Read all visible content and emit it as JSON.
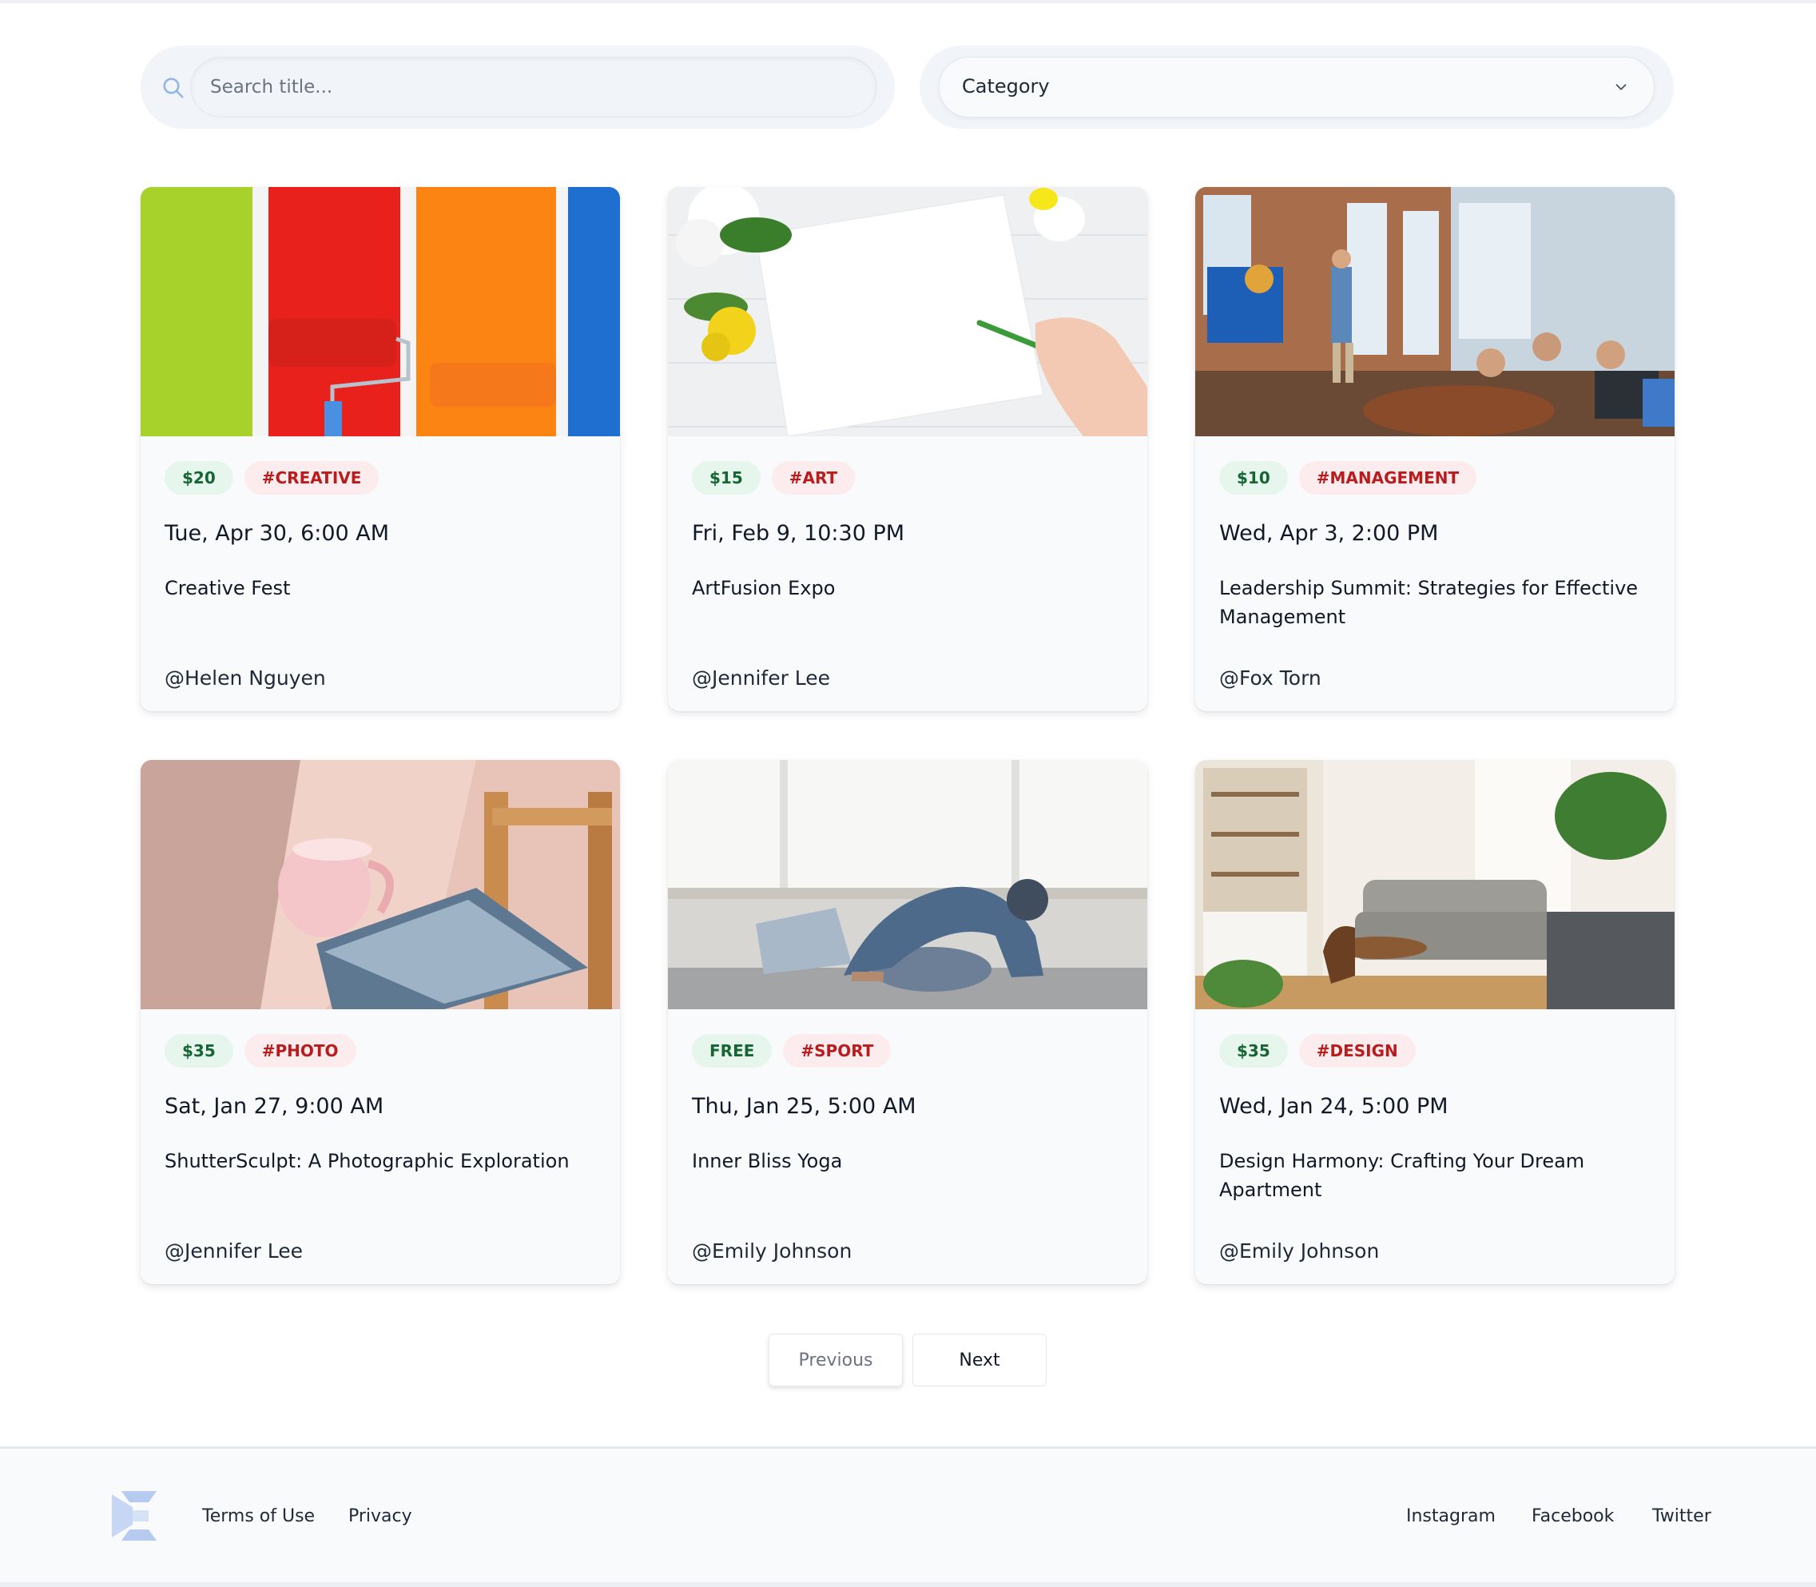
{
  "search": {
    "placeholder": "Search title..."
  },
  "filter": {
    "category_label": "Category"
  },
  "events": [
    {
      "price": "$20",
      "tag": "#CREATIVE",
      "date": "Tue, Apr 30, 6:00 AM",
      "title": "Creative Fest",
      "author": "@Helen Nguyen",
      "image": "paint-rollers-image"
    },
    {
      "price": "$15",
      "tag": "#ART",
      "date": "Fri, Feb 9, 10:30 PM",
      "title": "ArtFusion Expo",
      "author": "@Jennifer Lee",
      "image": "drawing-paper-image"
    },
    {
      "price": "$10",
      "tag": "#MANAGEMENT",
      "date": "Wed, Apr 3, 2:00 PM",
      "title": "Leadership Summit: Strategies for Effective Management",
      "author": "@Fox Torn",
      "image": "office-meeting-image"
    },
    {
      "price": "$35",
      "tag": "#PHOTO",
      "date": "Sat, Jan 27, 9:00 AM",
      "title": "ShutterSculpt: A Photographic Exploration",
      "author": "@Jennifer Lee",
      "image": "cup-magazine-image"
    },
    {
      "price": "FREE",
      "tag": "#SPORT",
      "date": "Thu, Jan 25, 5:00 AM",
      "title": "Inner Bliss Yoga",
      "author": "@Emily Johnson",
      "image": "yoga-pose-image"
    },
    {
      "price": "$35",
      "tag": "#DESIGN",
      "date": "Wed, Jan 24, 5:00 PM",
      "title": "Design Harmony: Crafting Your Dream Apartment",
      "author": "@Emily Johnson",
      "image": "living-room-image"
    }
  ],
  "pagination": {
    "previous": "Previous",
    "next": "Next"
  },
  "footer": {
    "left_links": [
      "Terms of Use",
      "Privacy"
    ],
    "right_links": [
      "Instagram",
      "Facebook",
      "Twitter"
    ]
  },
  "colors": {
    "price_bg": "#e7f6ec",
    "price_text": "#166534",
    "tag_bg": "#fdeced",
    "tag_text": "#b91c1c",
    "logo": "#c7d7f3"
  }
}
